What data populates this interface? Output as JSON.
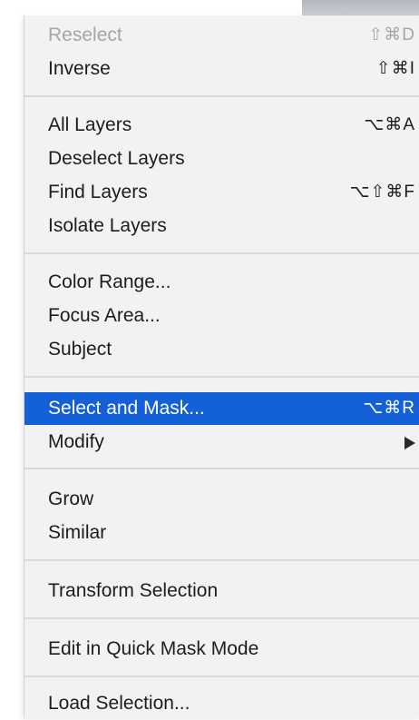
{
  "menu": {
    "items": [
      {
        "label": "Reselect",
        "shortcut": "⇧⌘D",
        "disabled": true
      },
      {
        "label": "Inverse",
        "shortcut": "⇧⌘I"
      },
      {
        "label": "All Layers",
        "shortcut": "⌥⌘A"
      },
      {
        "label": "Deselect Layers",
        "shortcut": ""
      },
      {
        "label": "Find Layers",
        "shortcut": "⌥⇧⌘F"
      },
      {
        "label": "Isolate Layers",
        "shortcut": ""
      },
      {
        "label": "Color Range...",
        "shortcut": ""
      },
      {
        "label": "Focus Area...",
        "shortcut": ""
      },
      {
        "label": "Subject",
        "shortcut": ""
      },
      {
        "label": "Select and Mask...",
        "shortcut": "⌥⌘R",
        "highlighted": true
      },
      {
        "label": "Modify",
        "shortcut": "",
        "submenu": true
      },
      {
        "label": "Grow",
        "shortcut": ""
      },
      {
        "label": "Similar",
        "shortcut": ""
      },
      {
        "label": "Transform Selection",
        "shortcut": ""
      },
      {
        "label": "Edit in Quick Mask Mode",
        "shortcut": ""
      },
      {
        "label": "Load Selection...",
        "shortcut": ""
      }
    ]
  },
  "colors": {
    "highlight": "#1360d9",
    "menu_background": "#f2f2f2",
    "disabled_text": "#a6a6a6"
  }
}
